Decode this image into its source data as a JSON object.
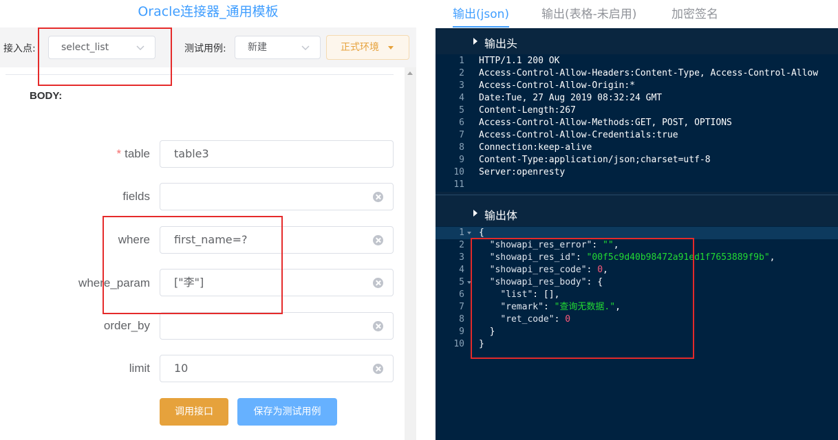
{
  "left": {
    "title": "Oracle连接器_通用模板",
    "access_point_label": "接入点:",
    "access_point_value": "select_list",
    "test_case_label": "测试用例:",
    "test_case_value": "新建",
    "env_button": "正式环境",
    "body_label": "BODY:",
    "fields": [
      {
        "label": "table",
        "required": "*",
        "value": "table3"
      },
      {
        "label": "fields",
        "value": ""
      },
      {
        "label": "where",
        "value": "first_name=?"
      },
      {
        "label": "where_param",
        "value": "[\"李\"]"
      },
      {
        "label": "order_by",
        "value": ""
      },
      {
        "label": "limit",
        "value": "10"
      }
    ],
    "call_button": "调用接口",
    "save_button": "保存为测试用例"
  },
  "right": {
    "tabs": [
      "输出(json)",
      "输出(表格-未启用)",
      "加密签名"
    ],
    "header_section": "输出头",
    "body_section": "输出体",
    "header_lines": [
      {
        "n": "1",
        "text": "HTTP/1.1 200 OK"
      },
      {
        "n": "2",
        "text": "Access-Control-Allow-Headers:Content-Type, Access-Control-Allow"
      },
      {
        "n": "3",
        "text": "Access-Control-Allow-Origin:*"
      },
      {
        "n": "4",
        "text": "Date:Tue, 27 Aug 2019 08:32:24 GMT"
      },
      {
        "n": "5",
        "text": "Content-Length:267"
      },
      {
        "n": "6",
        "text": "Access-Control-Allow-Methods:GET, POST, OPTIONS"
      },
      {
        "n": "7",
        "text": "Access-Control-Allow-Credentials:true"
      },
      {
        "n": "8",
        "text": "Connection:keep-alive"
      },
      {
        "n": "9",
        "text": "Content-Type:application/json;charset=utf-8"
      },
      {
        "n": "10",
        "text": "Server:openresty"
      },
      {
        "n": "11",
        "text": ""
      }
    ],
    "body_json": {
      "showapi_res_error": "",
      "showapi_res_id": "00f5c9d40b98472a91ed1f7653889f9b",
      "showapi_res_code": "0",
      "remark": "查询无数据.",
      "ret_code": "0"
    }
  },
  "colors": {
    "accent": "#409eff",
    "warning": "#e6a23c",
    "editor_bg": "#002240",
    "annotation": "#e52a2a"
  }
}
